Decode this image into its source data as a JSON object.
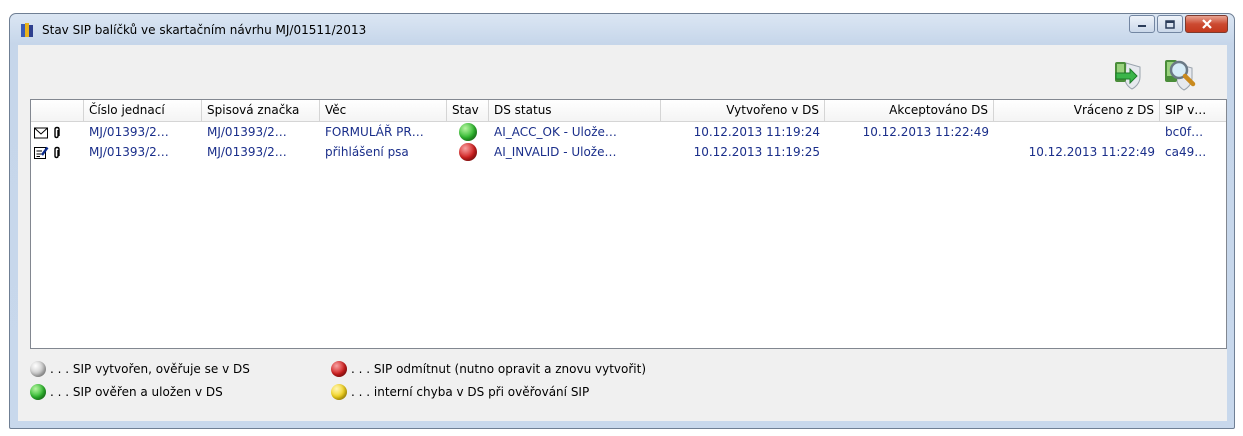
{
  "window": {
    "title": "Stav SIP balíčků ve skartačním návrhu MJ/01511/2013",
    "icon": "books-icon",
    "buttons": [
      "minimize-icon",
      "maximize-icon",
      "close-icon"
    ]
  },
  "toolbar": {
    "buttons": [
      {
        "name": "refresh-sip-button",
        "icon": "shield-arrow-icon"
      },
      {
        "name": "inspect-sip-button",
        "icon": "shield-magnifier-icon"
      }
    ]
  },
  "table": {
    "columns": [
      "",
      "Číslo jednací",
      "Spisová značka",
      "Věc",
      "Stav",
      "DS status",
      "Vytvořeno v DS",
      "Akceptováno DS",
      "Vráceno z DS",
      "SIP v…"
    ],
    "rows": [
      {
        "type_icon": "envelope-icon",
        "attach_icon": "paperclip-icon",
        "cislo": "MJ/01393/2…",
        "znacka": "MJ/01393/2…",
        "vec": "FORMULÁŘ PR…",
        "stav": "green",
        "ds_status": "AI_ACC_OK - Ulože…",
        "vytvoreno": "10.12.2013 11:19:24",
        "akceptovano": "10.12.2013 11:22:49",
        "vraceno": "",
        "sip": "bc0f…"
      },
      {
        "type_icon": "document-edit-icon",
        "attach_icon": "paperclip-icon",
        "cislo": "MJ/01393/2…",
        "znacka": "MJ/01393/2…",
        "vec": "přihlášení psa",
        "stav": "red",
        "ds_status": "AI_INVALID - Ulože…",
        "vytvoreno": "10.12.2013 11:19:25",
        "akceptovano": "",
        "vraceno": "10.12.2013 11:22:49",
        "sip": "ca49…"
      }
    ]
  },
  "legend": [
    {
      "color": "gray",
      "text": ". . . SIP vytvořen, ověřuje se v DS"
    },
    {
      "color": "green",
      "text": ". . . SIP ověřen a uložen v DS"
    },
    {
      "color": "red",
      "text": ". . . SIP odmítnut (nutno opravit a znovu vytvořit)"
    },
    {
      "color": "yellow",
      "text": ". . . interní chyba v DS při ověřování SIP"
    }
  ],
  "colors": {
    "link_text": "#1a2e8a",
    "green": "#2fb82f",
    "red": "#d11f1f",
    "gray": "#c8c8c8",
    "yellow": "#f2d21c"
  }
}
